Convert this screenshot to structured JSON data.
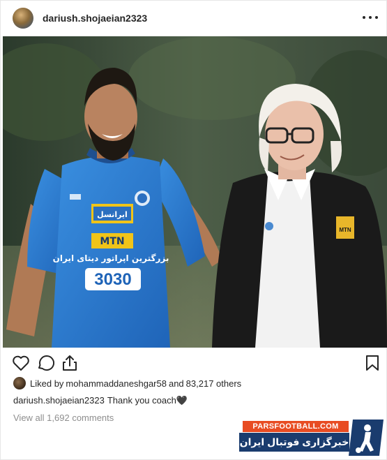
{
  "header": {
    "username": "dariush.shojaeian2323"
  },
  "photo": {
    "jersey_sponsor_top": "ایرانسل",
    "jersey_sponsor_brand": "MTN",
    "jersey_text": "بزرگترین اپراتور دیتای ایران",
    "jersey_number": "3030",
    "coach_badge": "MTN"
  },
  "likes": {
    "prefix": "Liked by",
    "user": "mohammaddaneshgar58",
    "joiner": "and",
    "others": "83,217 others"
  },
  "caption": {
    "user": "dariush.shojaeian2323",
    "text": "Thank you coach🖤"
  },
  "comments": {
    "label": "View all 1,692 comments"
  },
  "watermark": {
    "site": "PARSFOOTBALL.COM",
    "tagline": "خبرگزاری فوتبال ایران"
  },
  "colors": {
    "text": "#262626",
    "muted": "#8e8e8e",
    "watermark_orange": "#e84c22",
    "watermark_blue": "#1a3c6e",
    "jersey_blue": "#2e7fd4"
  },
  "icons": [
    "more-icon",
    "heart-icon",
    "comment-icon",
    "share-icon",
    "bookmark-icon"
  ]
}
